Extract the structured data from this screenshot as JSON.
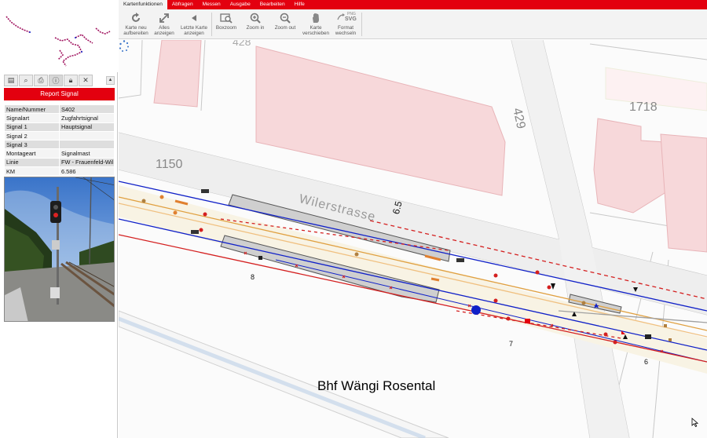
{
  "menu": {
    "tabs": [
      "Kartenfunktionen",
      "Abfragen",
      "Messen",
      "Ausgabe",
      "Bearbeiten",
      "Hilfe"
    ]
  },
  "toolbar": {
    "reload": [
      "Karte neu",
      "aufbereiten"
    ],
    "show_all": [
      "Alles",
      "anzeigen"
    ],
    "last_map": [
      "Letzte Karte",
      "anzeigen"
    ],
    "boxzoom": "Boxzoom",
    "zoom_in": "Zoom in",
    "zoom_out": "Zoom out",
    "pan": [
      "Karte",
      "verschieben"
    ],
    "format": [
      "Format",
      "wechseln"
    ],
    "format_badge": "PNG",
    "format_badge2": "SVG"
  },
  "panel": {
    "report_title": "Report Signal",
    "attributes": [
      {
        "key": "Name/Nummer",
        "value": "S402"
      },
      {
        "key": "Signalart",
        "value": "Zugfahrtsignal"
      },
      {
        "key": "Signal 1",
        "value": "Hauptsignal"
      },
      {
        "key": "Signal 2",
        "value": ""
      },
      {
        "key": "Signal 3",
        "value": ""
      },
      {
        "key": "Montageart",
        "value": "Signalmast"
      },
      {
        "key": "Linie",
        "value": "FW - Frauenfeld-Wil"
      },
      {
        "key": "KM",
        "value": "6.586"
      }
    ]
  },
  "map": {
    "station_label": "Bhf Wängi Rosental",
    "street_label": "Wilerstrasse",
    "parcel_labels": {
      "p1150": "1150",
      "p1718": "1718",
      "p429": "429",
      "p428": "428"
    },
    "km_label": "6.5",
    "track_labels": {
      "t8": "8",
      "t7": "7",
      "t6": "6"
    }
  },
  "colors": {
    "brand_red": "#e3000f",
    "track_blue": "#1020c8",
    "track_red": "#d42020",
    "building_pink": "#f7d8da"
  }
}
